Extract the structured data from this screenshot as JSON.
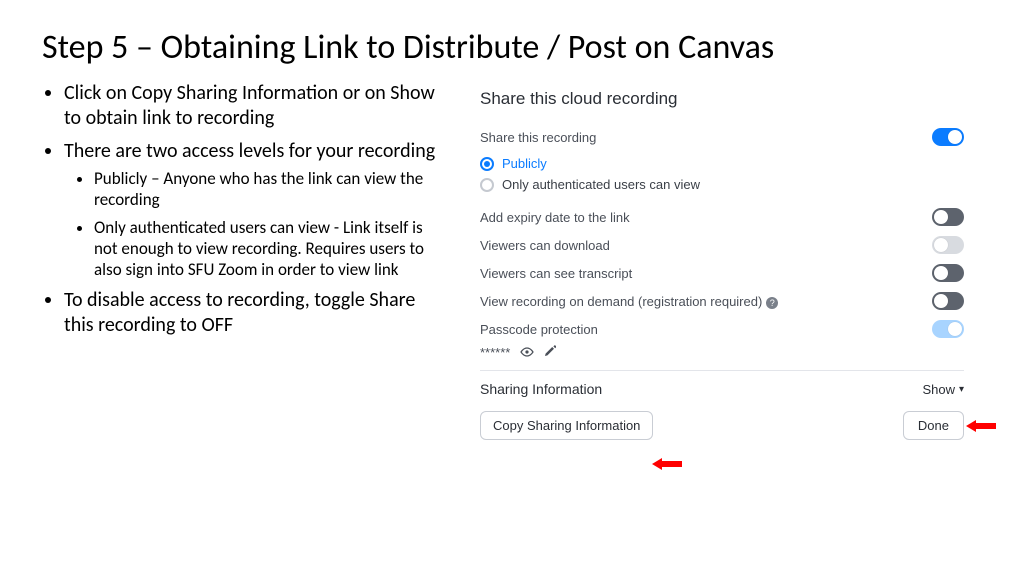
{
  "title": "Step 5 – Obtaining Link to Distribute / Post on Canvas",
  "bullets": {
    "b1": "Click on Copy Sharing Information or on Show to obtain link to recording",
    "b2": "There are two access levels for your recording",
    "b2a": "Publicly – Anyone who has the link can view the recording",
    "b2b": "Only authenticated users can view - Link itself is not enough to view recording. Requires users to also sign into SFU Zoom in order to view link",
    "b3": "To disable access to recording, toggle Share this recording to OFF"
  },
  "panel": {
    "title": "Share this cloud recording",
    "share_label": "Share this recording",
    "radio_public": "Publicly",
    "radio_auth": "Only authenticated users can view",
    "expiry": "Add expiry date to the link",
    "download": "Viewers can download",
    "transcript": "Viewers can see transcript",
    "ondemand": "View recording on demand (registration required)",
    "passcode": "Passcode protection",
    "passcode_mask": "******",
    "sharing_info": "Sharing Information",
    "show": "Show",
    "copy_btn": "Copy Sharing Information",
    "done_btn": "Done"
  }
}
